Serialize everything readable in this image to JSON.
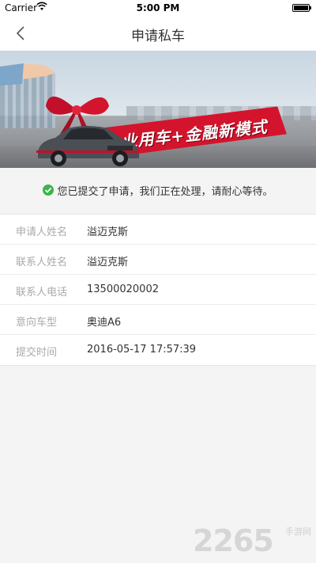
{
  "status_bar": {
    "carrier": "Carrier",
    "time": "5:00 PM",
    "battery_level": 1.0
  },
  "nav": {
    "title": "申请私车"
  },
  "banner": {
    "slogan": "企业用车+金融新模式"
  },
  "notice": {
    "text": "您已提交了申请，我们正在处理，请耐心等待。",
    "icon_color": "#3bb54a"
  },
  "info_rows": [
    {
      "label": "申请人姓名",
      "value": "溢迈克斯"
    },
    {
      "label": "联系人姓名",
      "value": "溢迈克斯"
    },
    {
      "label": "联系人电话",
      "value": "13500020002"
    },
    {
      "label": "意向车型",
      "value": "奥迪A6"
    },
    {
      "label": "提交时间",
      "value": "2016-05-17 17:57:39"
    }
  ],
  "watermark": {
    "number": "2265",
    "site": "手游网"
  },
  "colors": {
    "accent_red": "#d4142c",
    "nav_bg": "#ffffff",
    "page_bg": "#f4f4f4"
  }
}
